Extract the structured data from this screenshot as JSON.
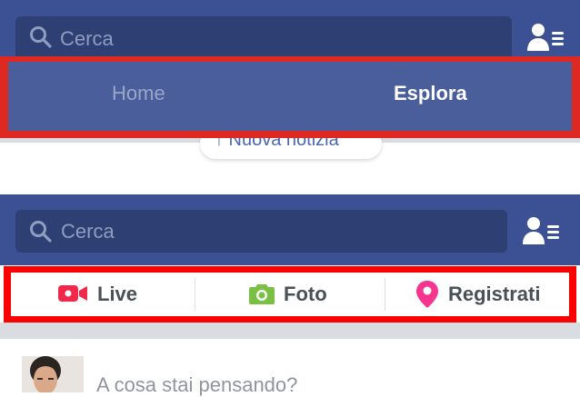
{
  "panel_top": {
    "search": {
      "placeholder": "Cerca",
      "icon": "search-icon"
    },
    "friends_icon": "friends-menu-icon",
    "tabs": [
      {
        "label": "Home",
        "state": "inactive"
      },
      {
        "label": "Esplora",
        "state": "active"
      }
    ],
    "new_story_pill": "↑ Nuova notizia",
    "highlight_color": "#dd2922"
  },
  "panel_bottom": {
    "search": {
      "placeholder": "Cerca",
      "icon": "search-icon"
    },
    "friends_icon": "friends-menu-icon",
    "actions": [
      {
        "label": "Live",
        "icon": "live-video-icon",
        "color": "#f02849"
      },
      {
        "label": "Foto",
        "icon": "camera-icon",
        "color": "#7ac143"
      },
      {
        "label": "Registrati",
        "icon": "location-pin-icon",
        "color": "#f5358f"
      }
    ],
    "highlight_color": "#ff0000",
    "composer_placeholder": "A cosa stai pensando?"
  },
  "colors": {
    "header_blue": "#3b5194",
    "search_bg": "#2e3f73"
  }
}
